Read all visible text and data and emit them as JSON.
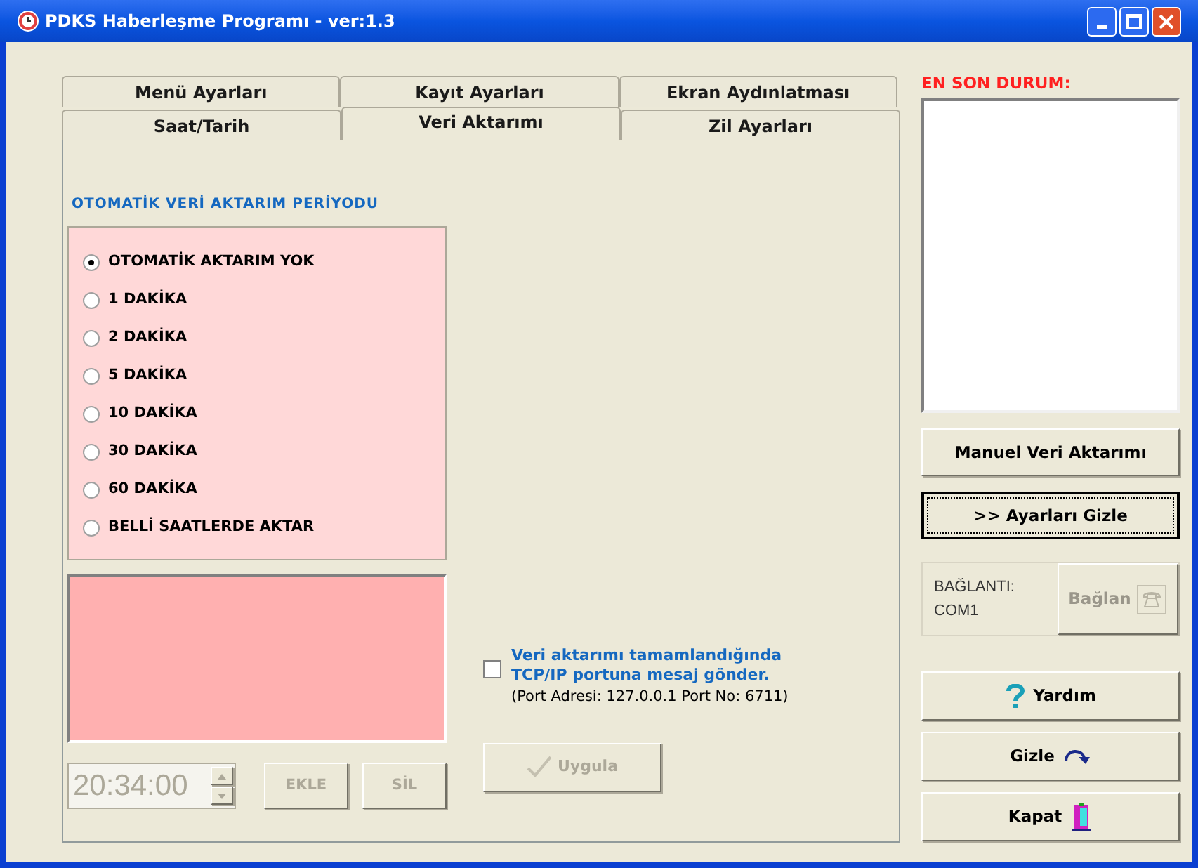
{
  "window": {
    "title": "PDKS Haberleşme Programı - ver:1.3"
  },
  "tab_rows": [
    {
      "tabs": [
        {
          "label": "Menü Ayarları",
          "selected": false
        },
        {
          "label": "Kayıt Ayarları",
          "selected": false
        },
        {
          "label": "Ekran Aydınlatması",
          "selected": false
        }
      ]
    },
    {
      "tabs": [
        {
          "label": "Saat/Tarih",
          "selected": false
        },
        {
          "label": "Veri Aktarımı",
          "selected": true
        },
        {
          "label": "Zil Ayarları",
          "selected": false
        }
      ]
    }
  ],
  "panel": {
    "section_title": "OTOMATİK VERİ AKTARIM PERİYODU",
    "radios": [
      {
        "label": "OTOMATİK AKTARIM YOK",
        "selected": true
      },
      {
        "label": "1 DAKİKA",
        "selected": false
      },
      {
        "label": "2 DAKİKA",
        "selected": false
      },
      {
        "label": "5 DAKİKA",
        "selected": false
      },
      {
        "label": "10 DAKİKA",
        "selected": false
      },
      {
        "label": "30 DAKİKA",
        "selected": false
      },
      {
        "label": "60 DAKİKA",
        "selected": false
      },
      {
        "label": "BELLİ SAATLERDE AKTAR",
        "selected": false
      }
    ],
    "time_field": {
      "value": "20:34:00",
      "disabled": true
    },
    "add_button": {
      "label": "EKLE",
      "disabled": true
    },
    "delete_button": {
      "label": "SİL",
      "disabled": true
    },
    "notify_checkbox": {
      "label": "Veri aktarımı tamamlandığında TCP/IP portuna mesaj gönder.",
      "checked": false
    },
    "port_info": "(Port Adresi: 127.0.0.1  Port No: 6711)",
    "apply_button": {
      "label": "Uygula",
      "disabled": true
    }
  },
  "status": {
    "title": "EN SON DURUM:"
  },
  "side_buttons": [
    {
      "label": "Manuel Veri Aktarımı",
      "default": false
    },
    {
      "label": ">> Ayarları Gizle",
      "default": true
    }
  ],
  "connection": {
    "label": "BAĞLANTI:",
    "port": "COM1",
    "connect_button": {
      "label": "Bağlan",
      "disabled": true
    }
  },
  "bottom_buttons": [
    {
      "label": "Yardım",
      "kind": "help"
    },
    {
      "label": "Gizle",
      "kind": "hide"
    },
    {
      "label": "Kapat",
      "kind": "exit"
    }
  ]
}
